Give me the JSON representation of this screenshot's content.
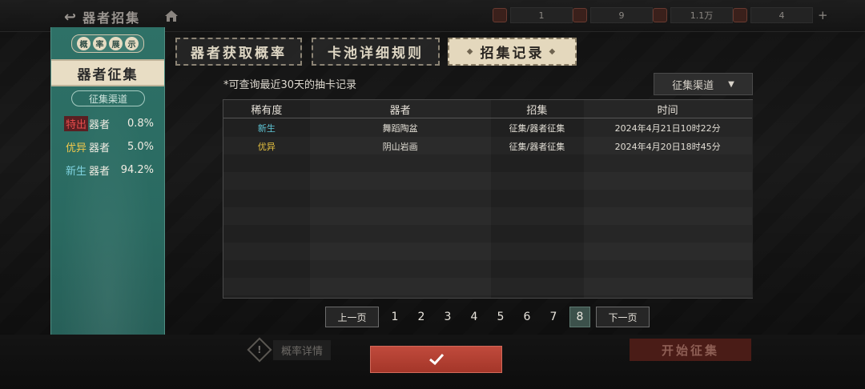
{
  "top_bar": {
    "back_label": "器者招集",
    "resources": [
      {
        "icon": "red-token-icon",
        "value": "1"
      },
      {
        "icon": "lantern-icon",
        "value": "9"
      },
      {
        "icon": "scroll-icon",
        "value": "1.1万"
      },
      {
        "icon": "badge-icon",
        "value": "4"
      }
    ]
  },
  "ticket": {
    "chip_chars": [
      "概",
      "率",
      "展",
      "示"
    ],
    "title": "器者征集",
    "channel": "征集渠道",
    "rates": [
      {
        "tag": "特出",
        "tag_color": "#e74c4c",
        "tag_bg": "#5a1f22",
        "label": "器者",
        "value": "0.8%"
      },
      {
        "tag": "优异",
        "tag_color": "#f2c94c",
        "tag_bg": "transparent",
        "label": "器者",
        "value": "5.0%"
      },
      {
        "tag": "新生",
        "tag_color": "#7fd3e0",
        "tag_bg": "transparent",
        "label": "器者",
        "value": "94.2%"
      }
    ]
  },
  "tabs": [
    {
      "label": "器者获取概率",
      "active": false
    },
    {
      "label": "卡池详细规则",
      "active": false
    },
    {
      "label": "招集记录",
      "active": true
    }
  ],
  "note": "*可查询最近30天的抽卡记录",
  "channel_select": {
    "label": "征集渠道"
  },
  "table": {
    "headers": [
      "稀有度",
      "器者",
      "招集",
      "时间"
    ],
    "rows": [
      {
        "rarity": "新生",
        "rarity_color": "#5fc6d6",
        "name": "舞蹈陶盆",
        "source": "征集/器者征集",
        "time": "2024年4月21日10时22分"
      },
      {
        "rarity": "优异",
        "rarity_color": "#e7c341",
        "name": "阴山岩画",
        "source": "征集/器者征集",
        "time": "2024年4月20日18时45分"
      }
    ]
  },
  "pagination": {
    "prev": "上一页",
    "next": "下一页",
    "pages": [
      "1",
      "2",
      "3",
      "4",
      "5",
      "6",
      "7",
      "8"
    ],
    "current": "8"
  },
  "bottom": {
    "prob_detail": "概率详情",
    "start": "开始征集"
  },
  "colors": {
    "accent_red": "#b84234",
    "teal": "#2c6b62",
    "cream": "#e4d8bd"
  }
}
